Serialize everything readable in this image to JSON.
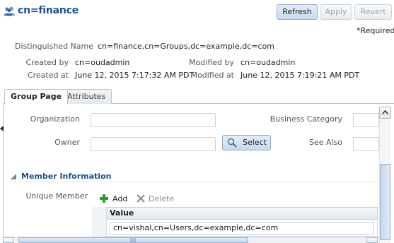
{
  "header": {
    "title": "cn=finance",
    "title_icon": "group-icon",
    "refresh_label": "Refresh",
    "apply_label": "Apply",
    "revert_label": "Revert",
    "required_note": "*Required"
  },
  "details": {
    "dn_label": "Distinguished Name",
    "dn_value": "cn=finance,cn=Groups,dc=example,dc=com",
    "created_by_label": "Created by",
    "created_by_value": "cn=oudadmin",
    "modified_by_label": "Modified by",
    "modified_by_value": "cn=oudadmin",
    "created_at_label": "Created at",
    "created_at_value": "June 12, 2015 7:17:32 AM PDT",
    "modified_at_label": "Modified at",
    "modified_at_value": "June 12, 2015 7:19:21 AM PDT"
  },
  "tabs": [
    {
      "label": "Group Page",
      "active": true
    },
    {
      "label": "Attributes",
      "active": false
    }
  ],
  "form": {
    "organization_label": "Organization",
    "organization_value": "",
    "business_category_label": "Business Category",
    "business_category_value": "",
    "owner_label": "Owner",
    "owner_value": "",
    "select_label": "Select",
    "see_also_label": "See Also",
    "see_also_value": ""
  },
  "member_section": {
    "title": "Member Information",
    "unique_member_label": "Unique Member",
    "add_label": "Add",
    "delete_label": "Delete",
    "table": {
      "column_header": "Value",
      "rows": [
        "cn=vishal,cn=Users,dc=example,dc=com"
      ]
    }
  },
  "colors": {
    "title": "#1f4f8a",
    "add_icon": "#2f9a2f",
    "delete_icon": "#8a9099"
  }
}
